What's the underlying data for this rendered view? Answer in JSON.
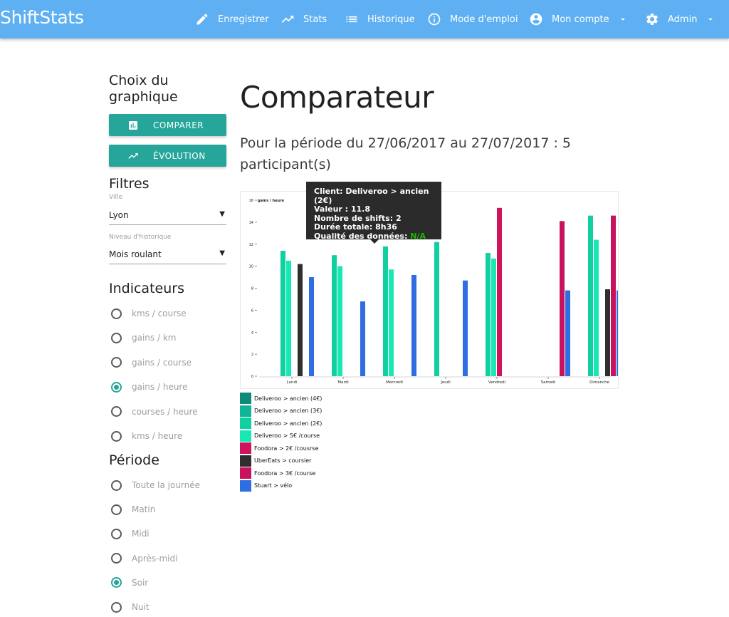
{
  "brand": "ShiftStats",
  "nav": {
    "enregistrer": "Enregistrer",
    "stats": "Stats",
    "historique": "Historique",
    "mode_emploi": "Mode d'emploi",
    "mon_compte": "Mon compte",
    "admin": "Admin"
  },
  "sidebar": {
    "choix_title": "Choix du graphique",
    "btn_comparer": "COMPARER",
    "btn_evolution": "ÉVOLUTION",
    "filtres_title": "Filtres",
    "ville_label": "Ville",
    "ville_value": "Lyon",
    "niveau_label": "Niveau d'historique",
    "niveau_value": "Mois roulant",
    "indicateurs_title": "Indicateurs",
    "indicateurs": [
      {
        "label": "kms / course",
        "selected": false
      },
      {
        "label": "gains / km",
        "selected": false
      },
      {
        "label": "gains / course",
        "selected": false
      },
      {
        "label": "gains / heure",
        "selected": true
      },
      {
        "label": "courses / heure",
        "selected": false
      },
      {
        "label": "kms / heure",
        "selected": false
      }
    ],
    "periode_title": "Période",
    "periodes": [
      {
        "label": "Toute la journée",
        "selected": false
      },
      {
        "label": "Matin",
        "selected": false
      },
      {
        "label": "Midi",
        "selected": false
      },
      {
        "label": "Après-midi",
        "selected": false
      },
      {
        "label": "Soir",
        "selected": true
      },
      {
        "label": "Nuit",
        "selected": false
      }
    ]
  },
  "main": {
    "title": "Comparateur",
    "subtitle": "Pour la période du 27/06/2017 au 27/07/2017 : 5 participant(s)"
  },
  "tooltip": {
    "client": "Client: Deliveroo > ancien (2€)",
    "valeur": "Valeur : 11.8",
    "shifts": "Nombre de shifts: 2",
    "duree": "Durée totale: 8h36",
    "qualite_label": "Qualité des données:",
    "qualite_value": "N/A"
  },
  "chart_data": {
    "type": "bar",
    "ylabel": "gains / heure",
    "ylim": [
      0,
      16
    ],
    "yticks": [
      0,
      2,
      4,
      6,
      8,
      10,
      12,
      14,
      16
    ],
    "categories": [
      "Lundi",
      "Mardi",
      "Mercredi",
      "Jeudi",
      "Vendredi",
      "Samedi",
      "Dimanche"
    ],
    "series": [
      {
        "name": "Deliveroo > ancien (4€)",
        "color": "#0d8a78",
        "values": [
          null,
          null,
          null,
          null,
          null,
          null,
          null
        ]
      },
      {
        "name": "Deliveroo > ancien (3€)",
        "color": "#10b498",
        "values": [
          null,
          null,
          null,
          null,
          null,
          null,
          null
        ]
      },
      {
        "name": "Deliveroo > ancien (2€)",
        "color": "#10d0a2",
        "values": [
          11.4,
          11.0,
          11.8,
          12.2,
          11.2,
          null,
          14.6
        ]
      },
      {
        "name": "Deliveroo > 5€ /course",
        "color": "#19e8b4",
        "values": [
          10.5,
          10.0,
          9.7,
          null,
          10.7,
          null,
          12.4
        ]
      },
      {
        "name": "Foodora > 2€ /cousrse",
        "color": "#d0135d",
        "values": [
          null,
          null,
          null,
          null,
          15.3,
          null,
          null
        ]
      },
      {
        "name": "UberEats > coursier",
        "color": "#2f2f2f",
        "values": [
          10.2,
          null,
          null,
          null,
          null,
          null,
          7.9
        ]
      },
      {
        "name": "Foodora > 3€ /course",
        "color": "#c8125e",
        "values": [
          null,
          null,
          null,
          null,
          null,
          14.1,
          14.6
        ]
      },
      {
        "name": "Stuart > vélo",
        "color": "#2f6ee0",
        "values": [
          9.0,
          6.8,
          9.2,
          8.7,
          null,
          7.8,
          7.8
        ]
      }
    ]
  }
}
